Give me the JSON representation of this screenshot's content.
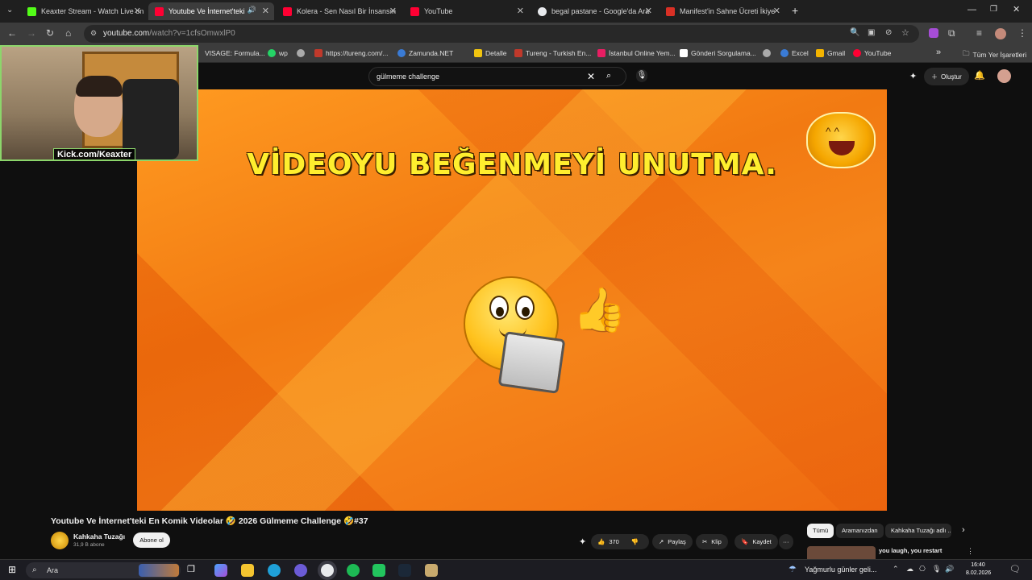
{
  "browser": {
    "tabs": [
      {
        "title": "Keaxter Stream - Watch Live on",
        "favicon_color": "#53fc18",
        "active": false
      },
      {
        "title": "Youtube Ve İnternet'teki En",
        "favicon_color": "#ff0033",
        "active": true
      },
      {
        "title": "Kolera - Sen Nasıl Bir İnsansın",
        "favicon_color": "#ff0033",
        "active": false
      },
      {
        "title": "YouTube",
        "favicon_color": "#ff0033",
        "active": false
      },
      {
        "title": "begal pastane - Google'da Ara",
        "favicon_color": "#e8eaed",
        "active": false
      },
      {
        "title": "Manifest'in Sahne Ücreti İkiye",
        "favicon_color": "#d93025",
        "active": false
      }
    ],
    "new_tab_label": "+",
    "url_host": "youtube.com",
    "url_path": "/watch?v=1cfsOmwxlP0",
    "bookmarks": [
      {
        "label": "VISAGE: Formula...",
        "color": "#888888"
      },
      {
        "label": "wp",
        "color": "#25d366"
      },
      {
        "label": "",
        "color": "#aaaaaa"
      },
      {
        "label": "https://tureng.com/...",
        "color": "#c0392b"
      },
      {
        "label": "Zamunda.NET",
        "color": "#3a7bd5"
      },
      {
        "label": "Detalle",
        "color": "#f1c40f"
      },
      {
        "label": "Tureng - Turkish En...",
        "color": "#c0392b"
      },
      {
        "label": "İstanbul Online Yem...",
        "color": "#e91e63"
      },
      {
        "label": "Gönderi Sorgulama...",
        "color": "#ffffff"
      },
      {
        "label": "",
        "color": "#aaaaaa"
      },
      {
        "label": "Excel",
        "color": "#3a7bd5"
      },
      {
        "label": "Gmail",
        "color": "#f4b400"
      },
      {
        "label": "YouTube",
        "color": "#ff0033"
      }
    ],
    "all_bookmarks_label": "Tüm Yer İşaretleri"
  },
  "youtube": {
    "search_query": "gülmeme challenge",
    "create_label": "Oluştur",
    "video_headline": "VİDEOYU BEĞENMEYİ UNUTMA.",
    "video_title": "Youtube Ve İnternet'teki En Komik Videolar 🤣 2026 Gülmeme Challenge 🤣#37",
    "channel_name": "Kahkaha Tuzağı",
    "subscriber_count": "31,9 B abone",
    "subscribe_label": "Abone ol",
    "like_count": "370",
    "share_label": "Paylaş",
    "clip_label": "Klip",
    "save_label": "Kaydet",
    "more_label": "···",
    "chips": [
      "Tümü",
      "Aramanızdan",
      "Kahkaha Tuzağı adlı ..."
    ],
    "rec_title": "you laugh, you restart"
  },
  "webcam": {
    "overlay_text": "Kick.com/Keaxter"
  },
  "taskbar": {
    "search_placeholder": "Ara",
    "weather_text": "Yağmurlu günler geli...",
    "time": "16:40",
    "date": "8.02.2026"
  }
}
